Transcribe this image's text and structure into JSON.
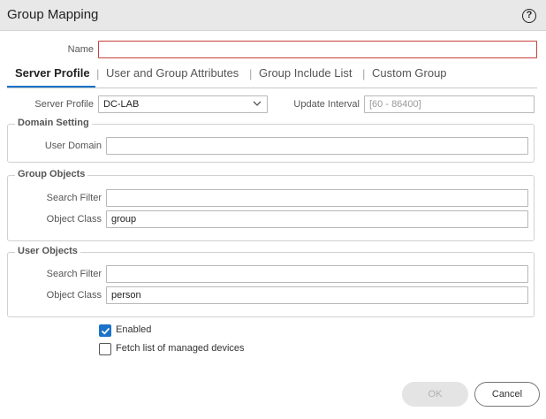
{
  "dialog": {
    "title": "Group Mapping",
    "help_icon": "question-circle-icon",
    "help_glyph": "?"
  },
  "name_field": {
    "label": "Name",
    "value": ""
  },
  "tabs": [
    {
      "label": "Server Profile",
      "active": true
    },
    {
      "label": "User and Group Attributes",
      "active": false
    },
    {
      "label": "Group Include List",
      "active": false
    },
    {
      "label": "Custom Group",
      "active": false
    }
  ],
  "tab_separator": "|",
  "server_profile": {
    "label": "Server Profile",
    "value": "DC-LAB"
  },
  "update_interval": {
    "label": "Update Interval",
    "placeholder": "[60 - 86400]",
    "value": ""
  },
  "domain_setting": {
    "legend": "Domain Setting",
    "user_domain": {
      "label": "User Domain",
      "value": ""
    }
  },
  "group_objects": {
    "legend": "Group Objects",
    "search_filter": {
      "label": "Search Filter",
      "value": ""
    },
    "object_class": {
      "label": "Object Class",
      "value": "group"
    }
  },
  "user_objects": {
    "legend": "User Objects",
    "search_filter": {
      "label": "Search Filter",
      "value": ""
    },
    "object_class": {
      "label": "Object Class",
      "value": "person"
    }
  },
  "checkboxes": {
    "enabled": {
      "label": "Enabled",
      "checked": true
    },
    "fetch_devices": {
      "label": "Fetch list of managed devices",
      "checked": false
    }
  },
  "buttons": {
    "ok": "OK",
    "cancel": "Cancel"
  },
  "colors": {
    "accent": "#1a73c8",
    "error_border": "#c9403d",
    "title_bar": "#e8e8e8"
  }
}
